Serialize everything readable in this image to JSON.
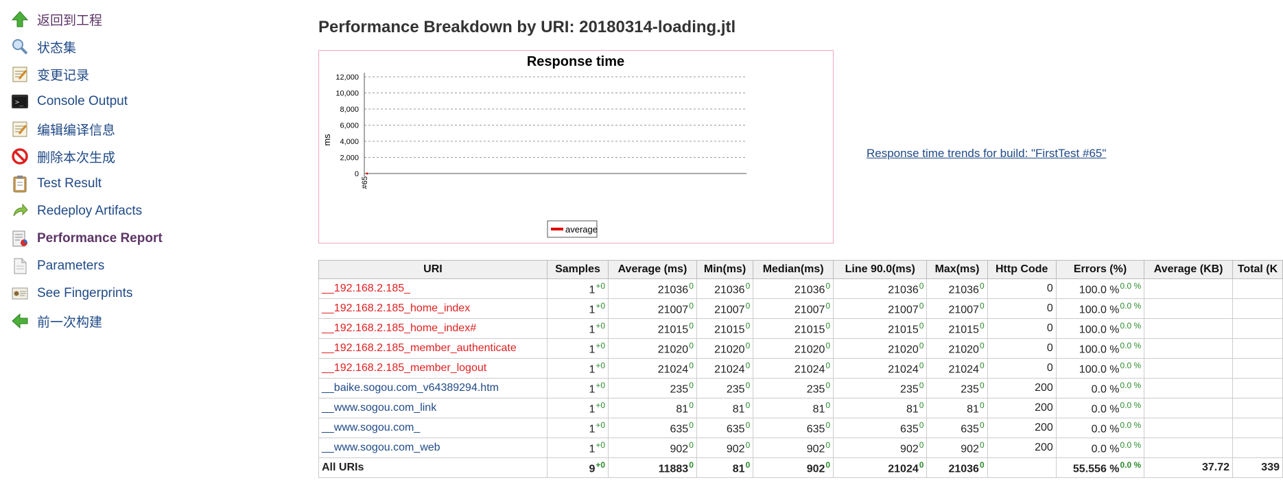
{
  "sidebar": {
    "items": [
      {
        "label": "返回到工程",
        "icon": "arrow-up-icon"
      },
      {
        "label": "状态集",
        "icon": "magnifier-icon"
      },
      {
        "label": "变更记录",
        "icon": "notepad-icon"
      },
      {
        "label": "Console Output",
        "icon": "terminal-icon"
      },
      {
        "label": "编辑编译信息",
        "icon": "notepad-icon"
      },
      {
        "label": "删除本次生成",
        "icon": "no-entry-icon"
      },
      {
        "label": "Test Result",
        "icon": "clipboard-icon"
      },
      {
        "label": "Redeploy Artifacts",
        "icon": "redeploy-icon"
      },
      {
        "label": "Performance Report",
        "icon": "performance-report-icon"
      },
      {
        "label": "Parameters",
        "icon": "document-icon"
      },
      {
        "label": "See Fingerprints",
        "icon": "fingerprint-icon"
      },
      {
        "label": "前一次构建",
        "icon": "arrow-left-icon"
      }
    ]
  },
  "main": {
    "title": "Performance Breakdown by URI: 20180314-loading.jtl",
    "trend_link": " Response time trends for build: \"FirstTest #65\""
  },
  "chart_data": {
    "type": "line",
    "title": "Response time",
    "ylabel": "ms",
    "xlabel": "",
    "categories": [
      "#65"
    ],
    "series": [
      {
        "name": "average",
        "values": [
          0
        ]
      }
    ],
    "ylim": [
      0,
      12000
    ],
    "yticks": [
      "12,000",
      "10,000",
      "8,000",
      "6,000",
      "4,000",
      "2,000",
      "0"
    ],
    "grid": true,
    "legend": "bottom-center",
    "colors": {
      "average": "#e00000"
    }
  },
  "table": {
    "headers": [
      "URI",
      "Samples",
      "Average (ms)",
      "Min(ms)",
      "Median(ms)",
      "Line 90.0(ms)",
      "Max(ms)",
      "Http Code",
      "Errors (%)",
      "Average (KB)",
      "Total (K"
    ],
    "rows": [
      {
        "uri": "__192.168.2.185_",
        "uri_color": "red",
        "samples": "1",
        "samples_diff": "+0",
        "avg": "21036",
        "avg_diff": "0",
        "min": "21036",
        "min_diff": "0",
        "median": "21036",
        "median_diff": "0",
        "line90": "21036",
        "line90_diff": "0",
        "max": "21036",
        "max_diff": "0",
        "http": "0",
        "errors": "100.0 %",
        "errors_diff": "0.0 %",
        "avg_kb": "",
        "total_kb": ""
      },
      {
        "uri": "__192.168.2.185_home_index",
        "uri_color": "red",
        "samples": "1",
        "samples_diff": "+0",
        "avg": "21007",
        "avg_diff": "0",
        "min": "21007",
        "min_diff": "0",
        "median": "21007",
        "median_diff": "0",
        "line90": "21007",
        "line90_diff": "0",
        "max": "21007",
        "max_diff": "0",
        "http": "0",
        "errors": "100.0 %",
        "errors_diff": "0.0 %",
        "avg_kb": "",
        "total_kb": ""
      },
      {
        "uri": "__192.168.2.185_home_index#",
        "uri_color": "red",
        "samples": "1",
        "samples_diff": "+0",
        "avg": "21015",
        "avg_diff": "0",
        "min": "21015",
        "min_diff": "0",
        "median": "21015",
        "median_diff": "0",
        "line90": "21015",
        "line90_diff": "0",
        "max": "21015",
        "max_diff": "0",
        "http": "0",
        "errors": "100.0 %",
        "errors_diff": "0.0 %",
        "avg_kb": "",
        "total_kb": ""
      },
      {
        "uri": "__192.168.2.185_member_authenticate",
        "uri_color": "red",
        "samples": "1",
        "samples_diff": "+0",
        "avg": "21020",
        "avg_diff": "0",
        "min": "21020",
        "min_diff": "0",
        "median": "21020",
        "median_diff": "0",
        "line90": "21020",
        "line90_diff": "0",
        "max": "21020",
        "max_diff": "0",
        "http": "0",
        "errors": "100.0 %",
        "errors_diff": "0.0 %",
        "avg_kb": "",
        "total_kb": ""
      },
      {
        "uri": "__192.168.2.185_member_logout",
        "uri_color": "red",
        "samples": "1",
        "samples_diff": "+0",
        "avg": "21024",
        "avg_diff": "0",
        "min": "21024",
        "min_diff": "0",
        "median": "21024",
        "median_diff": "0",
        "line90": "21024",
        "line90_diff": "0",
        "max": "21024",
        "max_diff": "0",
        "http": "0",
        "errors": "100.0 %",
        "errors_diff": "0.0 %",
        "avg_kb": "",
        "total_kb": ""
      },
      {
        "uri": "__baike.sogou.com_v64389294.htm",
        "uri_color": "blue",
        "samples": "1",
        "samples_diff": "+0",
        "avg": "235",
        "avg_diff": "0",
        "min": "235",
        "min_diff": "0",
        "median": "235",
        "median_diff": "0",
        "line90": "235",
        "line90_diff": "0",
        "max": "235",
        "max_diff": "0",
        "http": "200",
        "errors": "0.0 %",
        "errors_diff": "0.0 %",
        "avg_kb": "",
        "total_kb": ""
      },
      {
        "uri": "__www.sogou.com_link",
        "uri_color": "blue",
        "samples": "1",
        "samples_diff": "+0",
        "avg": "81",
        "avg_diff": "0",
        "min": "81",
        "min_diff": "0",
        "median": "81",
        "median_diff": "0",
        "line90": "81",
        "line90_diff": "0",
        "max": "81",
        "max_diff": "0",
        "http": "200",
        "errors": "0.0 %",
        "errors_diff": "0.0 %",
        "avg_kb": "",
        "total_kb": ""
      },
      {
        "uri": "__www.sogou.com_",
        "uri_color": "blue",
        "samples": "1",
        "samples_diff": "+0",
        "avg": "635",
        "avg_diff": "0",
        "min": "635",
        "min_diff": "0",
        "median": "635",
        "median_diff": "0",
        "line90": "635",
        "line90_diff": "0",
        "max": "635",
        "max_diff": "0",
        "http": "200",
        "errors": "0.0 %",
        "errors_diff": "0.0 %",
        "avg_kb": "",
        "total_kb": ""
      },
      {
        "uri": "__www.sogou.com_web",
        "uri_color": "blue",
        "samples": "1",
        "samples_diff": "+0",
        "avg": "902",
        "avg_diff": "0",
        "min": "902",
        "min_diff": "0",
        "median": "902",
        "median_diff": "0",
        "line90": "902",
        "line90_diff": "0",
        "max": "902",
        "max_diff": "0",
        "http": "200",
        "errors": "0.0 %",
        "errors_diff": "0.0 %",
        "avg_kb": "",
        "total_kb": ""
      }
    ],
    "total": {
      "label": "All URIs",
      "samples": "9",
      "samples_diff": "+0",
      "avg": "11883",
      "avg_diff": "0",
      "min": "81",
      "min_diff": "0",
      "median": "902",
      "median_diff": "0",
      "line90": "21024",
      "line90_diff": "0",
      "max": "21036",
      "max_diff": "0",
      "http": "",
      "errors": "55.556 %",
      "errors_diff": "0.0 %",
      "avg_kb": "37.72",
      "total_kb": "339"
    }
  }
}
